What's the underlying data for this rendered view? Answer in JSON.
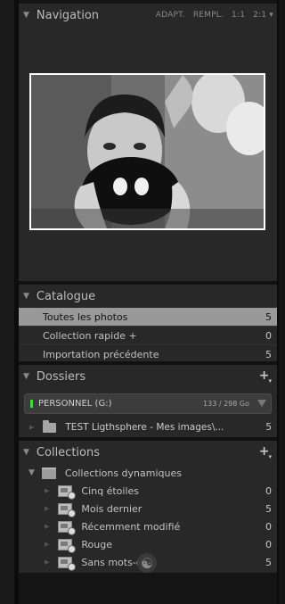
{
  "navigation": {
    "title": "Navigation",
    "options": [
      "ADAPT.",
      "REMPL.",
      "1:1",
      "2:1 ▾"
    ]
  },
  "catalogue": {
    "title": "Catalogue",
    "items": [
      {
        "label": "Toutes les photos",
        "count": "5"
      },
      {
        "label": "Collection rapide +",
        "count": "0"
      },
      {
        "label": "Importation précédente",
        "count": "5"
      }
    ]
  },
  "dossiers": {
    "title": "Dossiers",
    "add": "+",
    "volume": {
      "name": "PERSONNEL (G:)",
      "capacity": "133 / 298 Go"
    },
    "folders": [
      {
        "label": "TEST Ligthsphere - Mes images\\...",
        "count": "5"
      }
    ]
  },
  "collections": {
    "title": "Collections",
    "add": "+",
    "set": {
      "label": "Collections dynamiques"
    },
    "items": [
      {
        "label": "Cinq étoiles",
        "count": "0"
      },
      {
        "label": "Mois dernier",
        "count": "5"
      },
      {
        "label": "Récemment modifié",
        "count": "0"
      },
      {
        "label": "Rouge",
        "count": "0"
      },
      {
        "label": "Sans mots-clés",
        "count": "5"
      }
    ]
  },
  "footer": {
    "icon": "yin-yang-icon",
    "glyph": "☯"
  }
}
